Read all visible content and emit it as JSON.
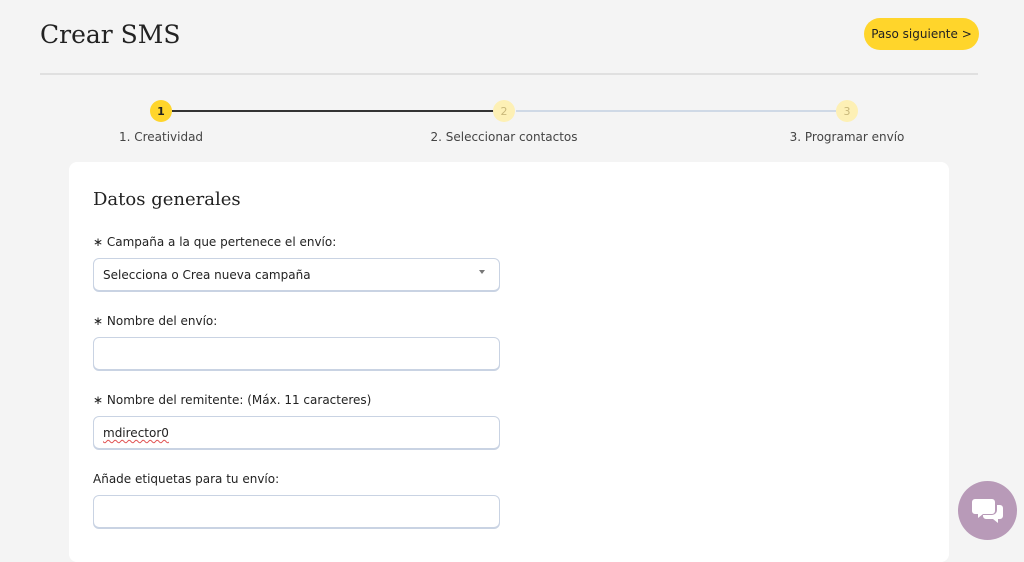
{
  "header": {
    "title": "Crear SMS",
    "next_button": "Paso siguiente >"
  },
  "stepper": {
    "steps": [
      {
        "number": "1",
        "label": "1. Creatividad",
        "state": "active"
      },
      {
        "number": "2",
        "label": "2. Seleccionar contactos",
        "state": "pending"
      },
      {
        "number": "3",
        "label": "3. Programar envío",
        "state": "pending"
      }
    ]
  },
  "form": {
    "section_title": "Datos generales",
    "campaign": {
      "label": "∗ Campaña a la que pertenece el envío:",
      "selected": "Selecciona o Crea nueva campaña"
    },
    "send_name": {
      "label": "∗ Nombre del envío:",
      "value": ""
    },
    "sender_name": {
      "label": "∗ Nombre del remitente: (Máx. 11 caracteres)",
      "value": "mdirector0"
    },
    "tags": {
      "label": "Añade etiquetas para tu envío:",
      "value": ""
    }
  },
  "colors": {
    "accent": "#ffd52b",
    "accent_light": "#fdf0b5",
    "chat_button": "#b89ab8"
  },
  "icons": {
    "chat": "chat-bubbles-icon",
    "dropdown": "caret-down-icon"
  }
}
